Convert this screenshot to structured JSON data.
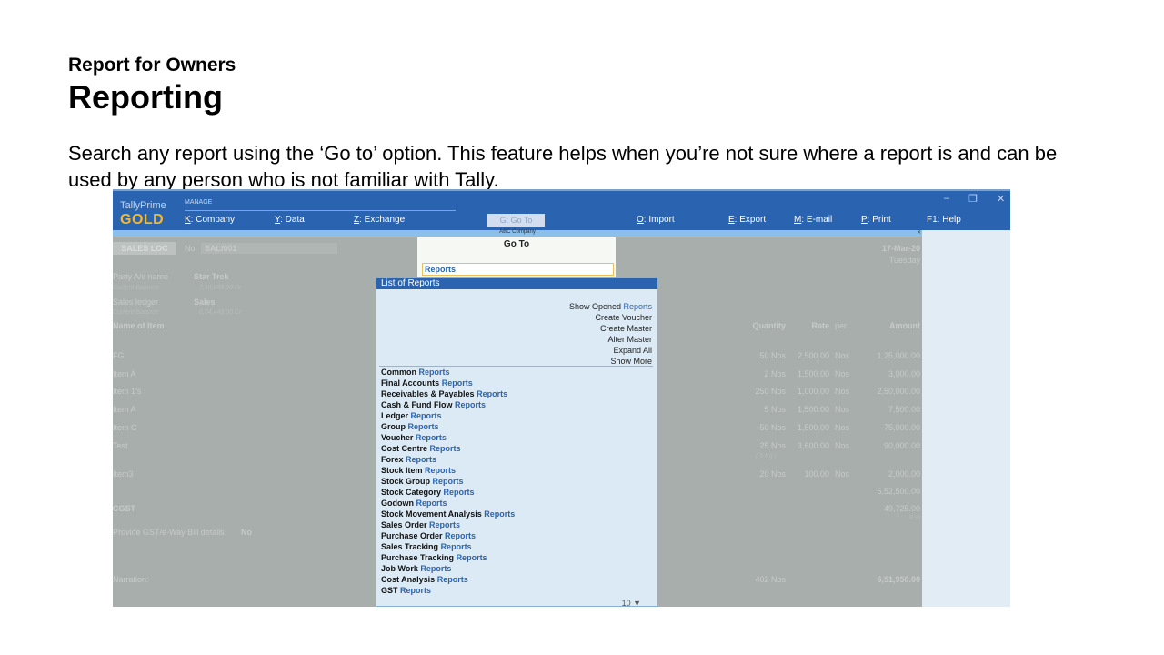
{
  "slide": {
    "subtitle": "Report for Owners",
    "title": "Reporting",
    "body": "Search any report using the ‘Go to’ option. This feature helps when you’re not sure where a report is and can be used by any person who is not familiar with Tally."
  },
  "app": {
    "brand_top": "TallyPrime",
    "brand_edition": "GOLD",
    "section_label": "MANAGE",
    "company_name": "ABC Company",
    "window_controls": {
      "minimize": "–",
      "restore": "❐",
      "close": "✕"
    },
    "menu": [
      {
        "key": "K",
        "label": ": Company"
      },
      {
        "key": "Y",
        "label": ": Data"
      },
      {
        "key": "Z",
        "label": ": Exchange"
      },
      {
        "key": "G",
        "label": ": Go To"
      },
      {
        "key": "O",
        "label": ": Import"
      },
      {
        "key": "E",
        "label": ": Export"
      },
      {
        "key": "M",
        "label": ": E-mail"
      },
      {
        "key": "P",
        "label": ": Print"
      },
      {
        "key": "F1",
        "label": ": Help"
      }
    ],
    "colors": {
      "topbar": "#2a64b0",
      "brand_gold": "#f2b736",
      "link_blue": "#2a64b0",
      "input_border": "#e8c15a"
    }
  },
  "voucher": {
    "type": "SALES LOC",
    "no_label": "No.",
    "no_value": "SAL/001",
    "date": "17-Mar-20",
    "day": "Tuesday",
    "party_label": "Party A/c name",
    "party_value": "Star Trek",
    "party_balance_label": "Current Balance",
    "party_balance": "7,16,838.00 Dr",
    "ledger_label": "Sales ledger",
    "ledger_value": "Sales",
    "ledger_balance_label": "Current Balance",
    "ledger_balance": "6,04,448.00 Cr",
    "col_item": "Name of Item",
    "col_qty": "Quantity",
    "col_rate": "Rate",
    "col_per": "per",
    "col_amount": "Amount",
    "rows": [
      {
        "item": "FG",
        "qty": "50 Nos",
        "rate": "2,500.00",
        "per": "Nos",
        "amount": "1,25,000.00"
      },
      {
        "item": "Item A",
        "qty": "2 Nos",
        "rate": "1,500.00",
        "per": "Nos",
        "amount": "3,000.00"
      },
      {
        "item": "Item 1's",
        "qty": "250 Nos",
        "rate": "1,000.00",
        "per": "Nos",
        "amount": "2,50,000.00"
      },
      {
        "item": "Item A",
        "qty": "5 Nos",
        "rate": "1,500.00",
        "per": "Nos",
        "amount": "7,500.00"
      },
      {
        "item": "Item C",
        "qty": "50 Nos",
        "rate": "1,500.00",
        "per": "Nos",
        "amount": "75,000.00"
      },
      {
        "item": "Test",
        "qty": "25 Nos",
        "rate": "3,600.00",
        "per": "Nos",
        "amount": "90,000.00"
      },
      {
        "item": "Item3",
        "qty": "20 Nos",
        "rate": "100.00",
        "per": "Nos",
        "amount": "2,000.00"
      }
    ],
    "test_sub": "( 5 Kg )",
    "subtotal": "5,52,500.00",
    "tax_label": "CGST",
    "tax_amount": "49,725.00",
    "tax_rate": "9 %",
    "eway_label": "Provide GST/e-Way Bill details",
    "eway_value": "No",
    "narration_label": "Narration:",
    "total_qty": "402 Nos",
    "total_amount": "6,51,950.00"
  },
  "goto": {
    "title": "Go To",
    "input_value": "Reports",
    "list_title": "List of Reports",
    "actions": [
      {
        "plain": "Show Opened ",
        "highlight": "Reports"
      },
      {
        "plain": "Create Voucher",
        "highlight": ""
      },
      {
        "plain": "Create Master",
        "highlight": ""
      },
      {
        "plain": "Alter Master",
        "highlight": ""
      },
      {
        "plain": "Expand All",
        "highlight": ""
      },
      {
        "plain": "Show More",
        "highlight": ""
      }
    ],
    "keyword": "Reports",
    "items": [
      "Common",
      "Final Accounts",
      "Receivables & Payables",
      "Cash & Fund Flow",
      "Ledger",
      "Group",
      "Voucher",
      "Cost Centre",
      "Forex",
      "Stock Item",
      "Stock Group",
      "Stock Category",
      "Godown",
      "Stock Movement Analysis",
      "Sales Order",
      "Purchase Order",
      "Sales Tracking",
      "Purchase Tracking",
      "Job Work",
      "Cost Analysis",
      "GST"
    ],
    "pager": "10 ▼"
  }
}
